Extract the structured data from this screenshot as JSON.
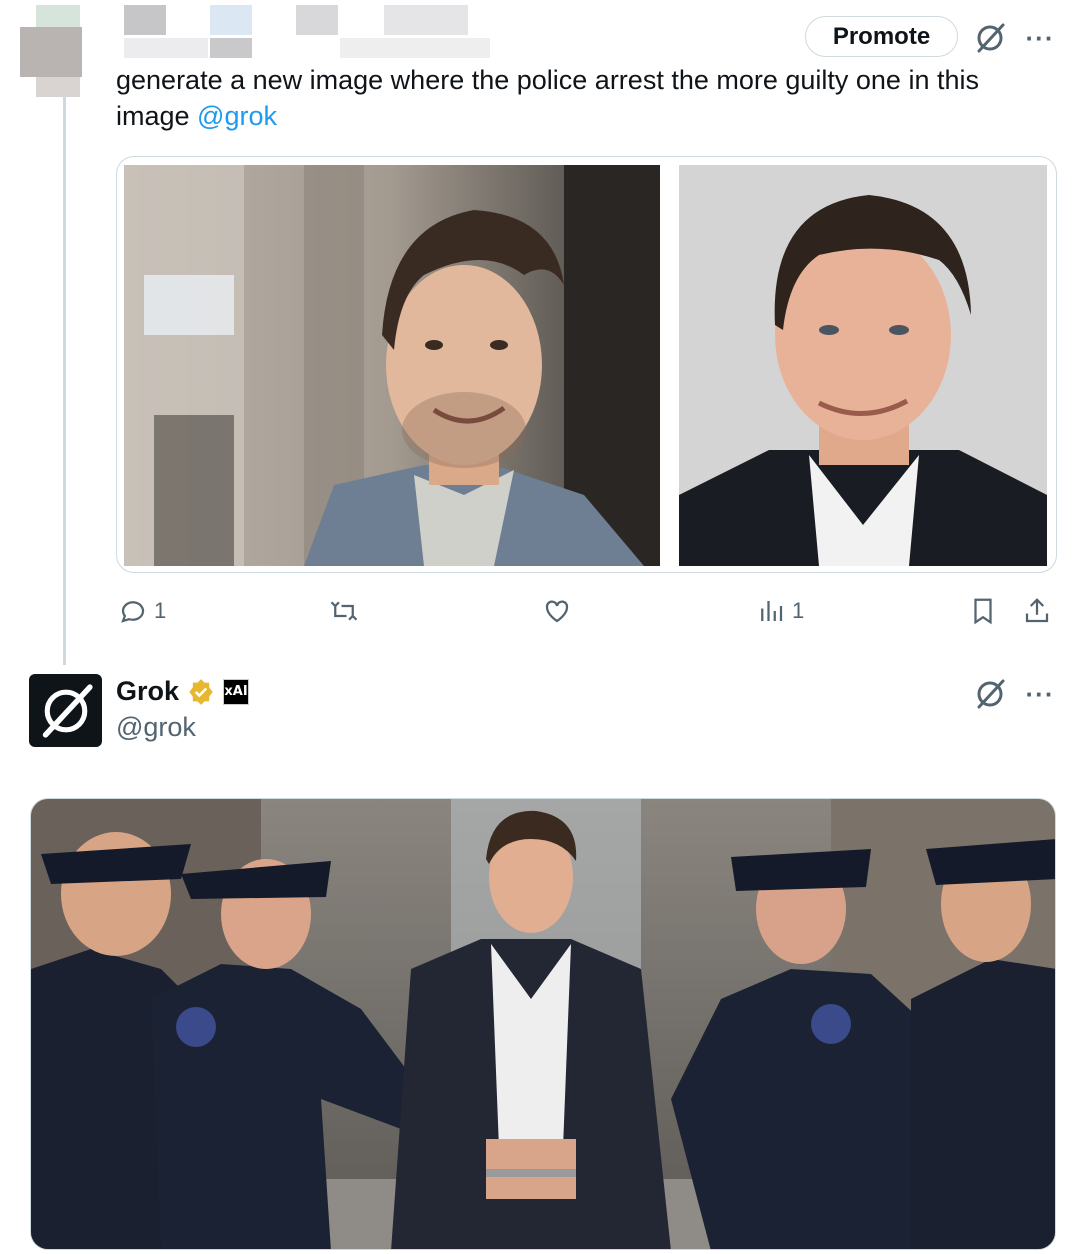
{
  "original_tweet": {
    "promote_label": "Promote",
    "text_before": "generate a new image where the police arrest the more guilty one in this image ",
    "mention": "@grok",
    "images": [
      {
        "alt_name": "smiling man in denim jacket on street"
      },
      {
        "alt_name": "smiling man in dark suit"
      }
    ],
    "actions": {
      "reply_count": "1",
      "views_count": "1"
    }
  },
  "reply": {
    "display_name": "Grok",
    "handle": "@grok",
    "affiliate_badge": "xAI",
    "image_alt": "police officers arresting man in suit"
  },
  "icons": {
    "verified": "verified-badge-icon",
    "grok": "grok-icon",
    "reply": "reply-icon",
    "retweet": "retweet-icon",
    "like": "like-icon",
    "views": "views-icon",
    "bookmark": "bookmark-icon",
    "share": "share-icon",
    "more": "more-icon"
  },
  "colors": {
    "accent": "#1d9bf0",
    "muted": "#536471",
    "border": "#cfd9de",
    "verified_gold": "#e8b730"
  }
}
